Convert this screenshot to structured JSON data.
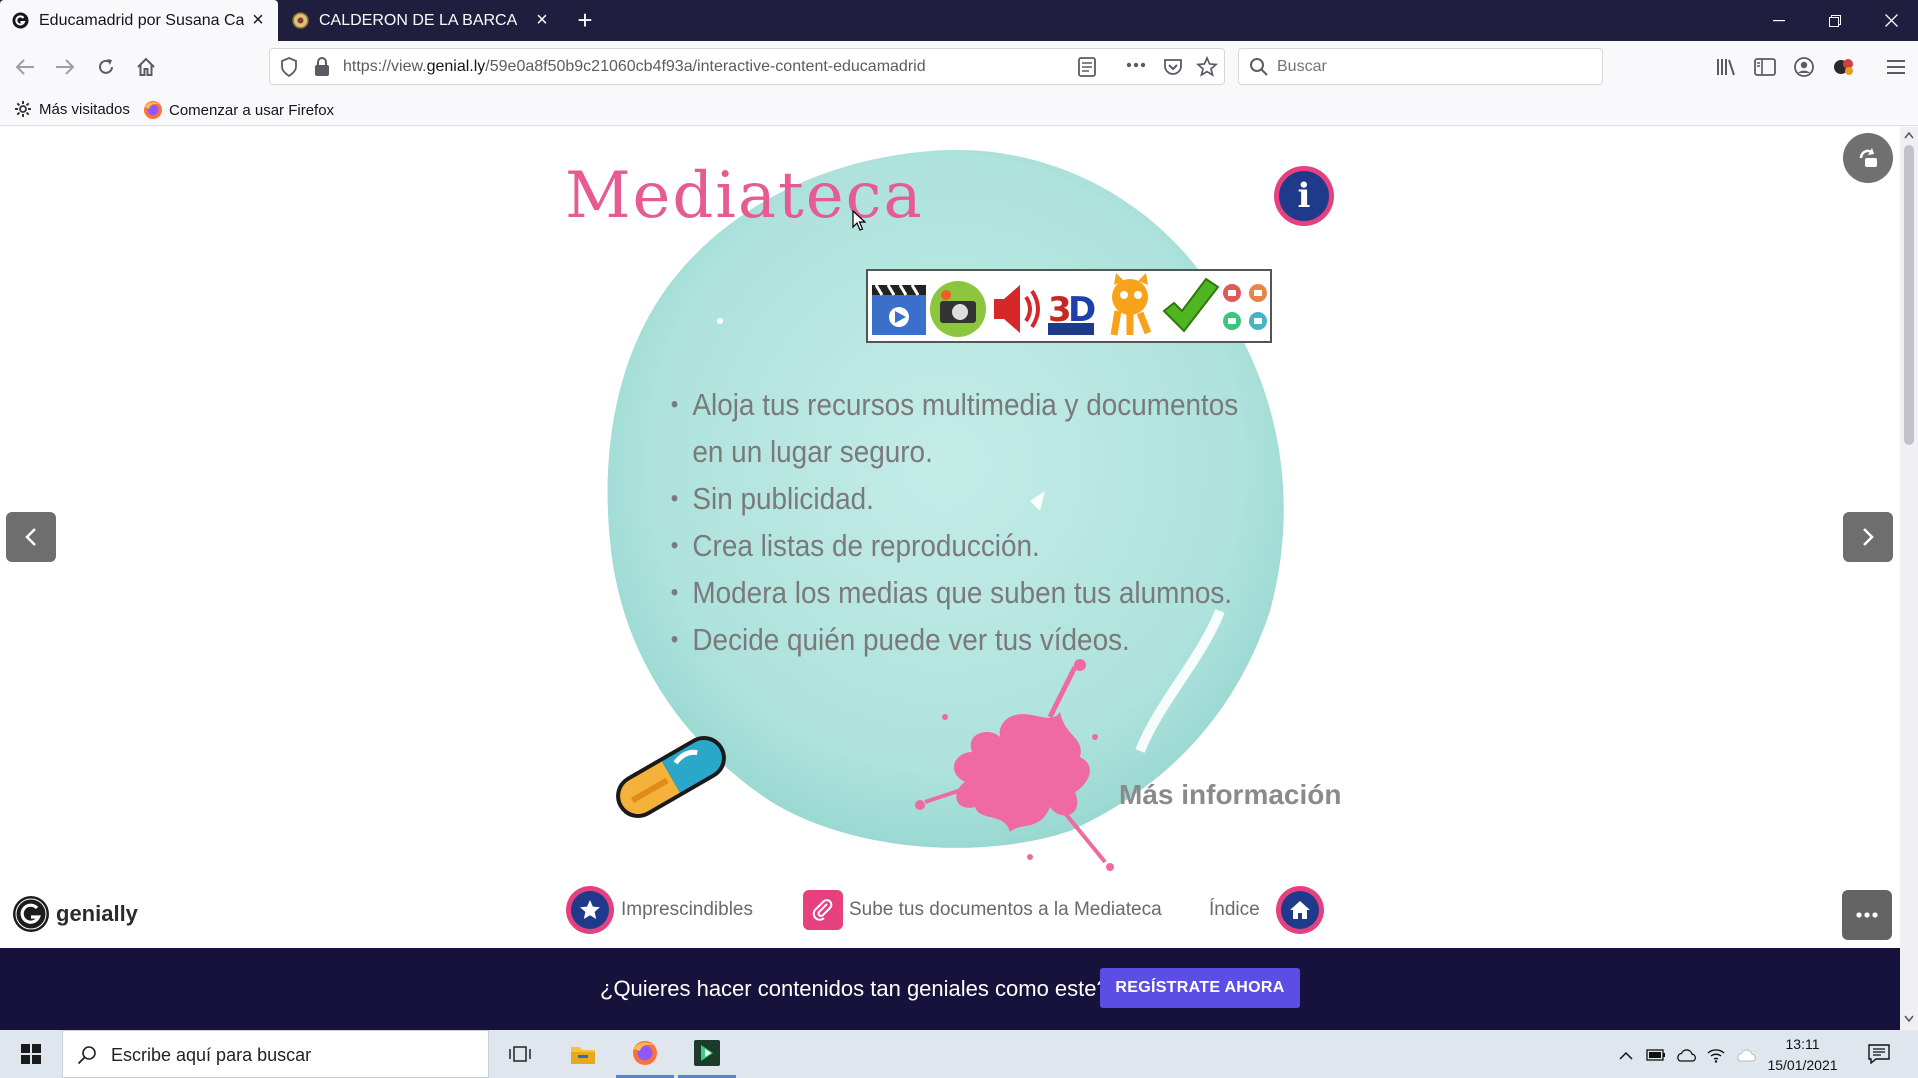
{
  "browser": {
    "tabs": [
      {
        "title": "Educamadrid por Susana Canta",
        "active": true
      },
      {
        "title": "CALDERON DE LA BARCA",
        "active": false
      }
    ],
    "new_tab_symbol": "+",
    "url_prefix": "https://view.",
    "url_host": "genial.ly",
    "url_path": "/59e0a8f50b9c21060cb4f93a/interactive-content-educamadrid",
    "search_placeholder": "Buscar",
    "bookmarks": [
      {
        "label": "Más visitados",
        "icon": "gear-icon"
      },
      {
        "label": "Comenzar a usar Firefox",
        "icon": "firefox-icon"
      }
    ]
  },
  "slide": {
    "title": "Mediateca",
    "info_symbol": "i",
    "bullets": [
      "Aloja tus recursos multimedia y documentos",
      "en un lugar seguro.",
      "Sin publicidad.",
      "Crea listas de reproducción.",
      "Modera los medias que suben tus alumnos.",
      "Decide quién puede ver tus vídeos."
    ],
    "more_info": "Más información",
    "bottom_links": {
      "essentials": "Imprescindibles",
      "upload": "Sube tus documentos a la Mediateca",
      "index": "Índice"
    },
    "brand": "genially"
  },
  "promo": {
    "text": "¿Quieres hacer contenidos tan geniales como este?",
    "button": "REGÍSTRATE AHORA"
  },
  "taskbar": {
    "search_placeholder": "Escribe aquí para buscar",
    "time": "13:11",
    "date": "15/01/2021"
  },
  "colors": {
    "accent_pink": "#e6407e",
    "accent_navy": "#1f3a8a",
    "blob_teal": "#b7e6e1",
    "promo_bg": "#17123b",
    "promo_button": "#5c4ee5"
  }
}
